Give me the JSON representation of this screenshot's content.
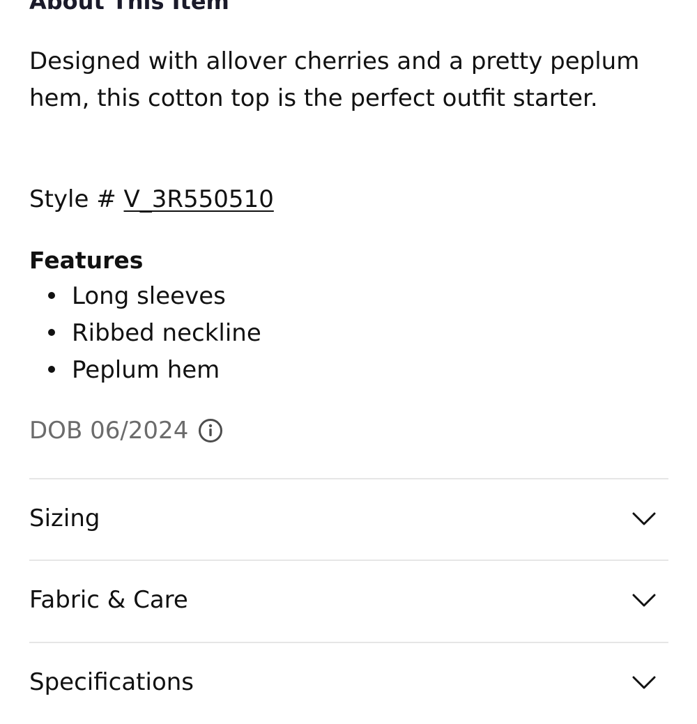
{
  "about": {
    "title": "About This Item",
    "description": "Designed with allover cherries and a pretty peplum hem, this cotton top is the perfect outfit starter."
  },
  "style": {
    "label": "Style # ",
    "number": "V_3R550510"
  },
  "features": {
    "title": "Features",
    "items": [
      "Long sleeves",
      "Ribbed neckline",
      "Peplum hem"
    ]
  },
  "dob": {
    "text": "DOB 06/2024",
    "icon": "info-icon"
  },
  "accordions": [
    {
      "label": "Sizing",
      "icon": "chevron-down-icon"
    },
    {
      "label": "Fabric & Care",
      "icon": "chevron-down-icon"
    },
    {
      "label": "Specifications",
      "icon": "chevron-down-icon"
    }
  ],
  "colors": {
    "text": "#111111",
    "muted": "#6b6b6b",
    "divider": "#e6e6e6",
    "background": "#ffffff"
  }
}
